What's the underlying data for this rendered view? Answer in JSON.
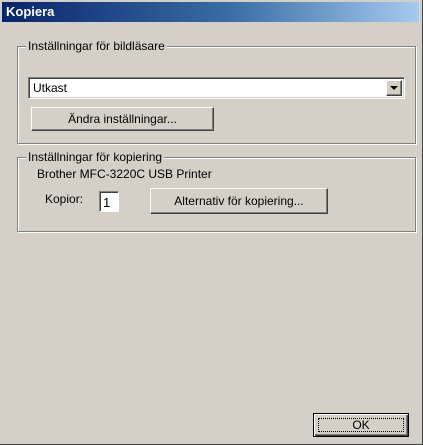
{
  "window": {
    "title": "Kopiera"
  },
  "scanner_settings": {
    "group_label": "Inställningar för bildläsare",
    "profile_value": "Utkast",
    "change_settings_label": "Ändra inställningar..."
  },
  "copy_settings": {
    "group_label": "Inställningar för kopiering",
    "printer_name": "Brother MFC-3220C USB Printer",
    "copies_label": "Kopior:",
    "copies_value": "1",
    "copy_options_label": "Alternativ för kopiering..."
  },
  "footer": {
    "ok_label": "OK"
  }
}
